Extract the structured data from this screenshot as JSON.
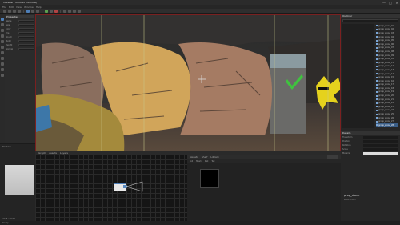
{
  "window": {
    "title": "Material - Untitled (Window)",
    "controls": [
      "—",
      "□",
      "✕"
    ]
  },
  "menu": [
    "File",
    "Edit",
    "View",
    "Window",
    "Help"
  ],
  "viewport_tabs": [
    "Graph",
    "Assets",
    "Layers"
  ],
  "left_panel": {
    "header": "Properties",
    "rows": [
      {
        "label": "Name"
      },
      {
        "label": "Size"
      },
      {
        "label": "Color"
      },
      {
        "label": "Tile"
      },
      {
        "label": "Rough"
      },
      {
        "label": "Metal"
      },
      {
        "label": "Height"
      },
      {
        "label": "Normal"
      }
    ]
  },
  "preview": {
    "label": "Preview",
    "info": "2048 x 2048"
  },
  "assets": {
    "tabs": [
      "Assets",
      "Shelf",
      "Library"
    ],
    "filters": [
      "All",
      "Mesh",
      "Mat",
      "Tex"
    ]
  },
  "outliner": {
    "header": "Outliner",
    "items": [
      "group_stone_01",
      "group_stone_02",
      "group_stone_03",
      "group_stone_04",
      "group_stone_05",
      "group_stone_06",
      "group_stone_07",
      "group_stone_08",
      "group_stone_09",
      "group_stone_10",
      "group_stone_11",
      "group_stone_12",
      "group_stone_13",
      "group_stone_14",
      "group_stone_15",
      "group_stone_16",
      "group_stone_17",
      "group_stone_18",
      "group_stone_19",
      "group_stone_20",
      "group_stone_21",
      "group_stone_22",
      "group_stone_23",
      "group_stone_24",
      "group_stone_25",
      "group_stone_26",
      "group_stone_27",
      "group_stone_28"
    ],
    "selected_index": 27
  },
  "detail": {
    "header": "Details",
    "rows": [
      {
        "label": "Transform",
        "white": false
      },
      {
        "label": "Position",
        "white": false
      },
      {
        "label": "Rotation",
        "white": false
      },
      {
        "label": "Scale",
        "white": false
      },
      {
        "label": "Material",
        "white": true
      }
    ],
    "name": "prop_stone",
    "sub": "static mesh"
  },
  "status": "Ready",
  "colors": {
    "accent": "#4e7fb8",
    "viewport_border": "#7a2020"
  }
}
